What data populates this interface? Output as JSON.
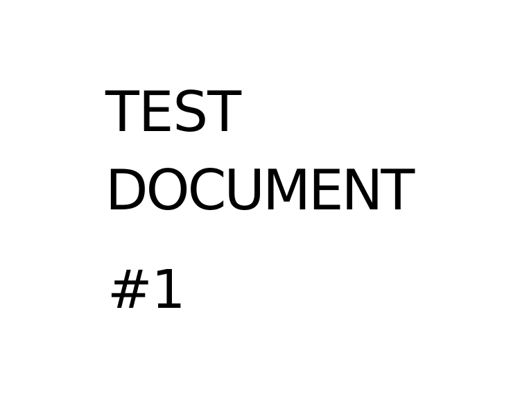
{
  "document": {
    "lines": [
      "TEST",
      "DOCUMENT",
      "#1"
    ],
    "text_color": "#000000",
    "background_color": "#ffffff"
  }
}
